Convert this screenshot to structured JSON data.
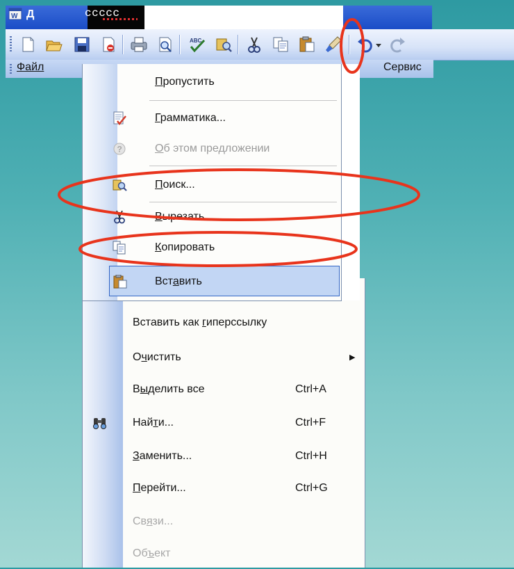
{
  "title_bar": {
    "selected_text": "ccccc",
    "window_title_fragment": "Д"
  },
  "toolbar": {
    "buttons": [
      {
        "icon": "new-document-icon"
      },
      {
        "icon": "open-folder-icon"
      },
      {
        "icon": "save-icon"
      },
      {
        "icon": "permission-icon"
      },
      {
        "icon": "print-icon"
      },
      {
        "icon": "print-preview-icon"
      },
      {
        "icon": "spelling-icon"
      },
      {
        "icon": "research-icon"
      },
      {
        "icon": "cut-icon"
      },
      {
        "icon": "copy-icon"
      },
      {
        "icon": "paste-icon"
      },
      {
        "icon": "format-painter-icon"
      },
      {
        "icon": "undo-icon"
      },
      {
        "icon": "redo-icon"
      }
    ]
  },
  "menubar": {
    "file_label": "Файл",
    "tools_label": "Сервис"
  },
  "context_menu": {
    "items": [
      {
        "label": "Пропустить",
        "underline": "П",
        "rest": "ропустить",
        "enabled": true
      },
      {
        "label": "Грамматика...",
        "underline": "Г",
        "rest": "рамматика...",
        "enabled": true,
        "icon": "grammar-icon"
      },
      {
        "label": "Об этом предложении",
        "underline": "О",
        "rest": "б этом предложении",
        "enabled": false,
        "icon": "help-icon"
      },
      {
        "label": "Поиск...",
        "underline": "П",
        "rest": "оиск...",
        "enabled": true,
        "icon": "research-icon"
      },
      {
        "label": "Вырезать",
        "underline": "В",
        "rest": "ырезать",
        "enabled": true,
        "icon": "cut-icon"
      },
      {
        "label": "Копировать",
        "underline": "К",
        "rest": "опировать",
        "enabled": true,
        "icon": "copy-icon"
      },
      {
        "label": "Вставить",
        "pre": "Вст",
        "underline": "а",
        "rest": "вить",
        "enabled": true,
        "icon": "paste-icon",
        "highlighted": true
      }
    ]
  },
  "edit_menu": {
    "items": [
      {
        "label": "Вставить как гиперссылку",
        "pre": "Вставить как ",
        "underline": "г",
        "rest": "иперссылку",
        "shortcut": "",
        "enabled": true
      },
      {
        "label": "Очистить",
        "pre": "О",
        "underline": "ч",
        "rest": "истить",
        "shortcut": "",
        "submenu": true,
        "enabled": true
      },
      {
        "label": "Выделить все",
        "pre": "В",
        "underline": "ы",
        "rest": "делить все",
        "shortcut": "Ctrl+A",
        "enabled": true
      },
      {
        "label": "Найти...",
        "pre": "Най",
        "underline": "т",
        "rest": "и...",
        "shortcut": "Ctrl+F",
        "enabled": true,
        "icon": "find-binoculars-icon"
      },
      {
        "label": "Заменить...",
        "pre": "",
        "underline": "З",
        "rest": "аменить...",
        "shortcut": "Ctrl+H",
        "enabled": true
      },
      {
        "label": "Перейти...",
        "pre": "",
        "underline": "П",
        "rest": "ерейти...",
        "shortcut": "Ctrl+G",
        "enabled": true
      },
      {
        "label": "Связи...",
        "pre": "Св",
        "underline": "я",
        "rest": "зи...",
        "shortcut": "",
        "enabled": false
      },
      {
        "label": "Объект",
        "pre": "Об",
        "underline": "ъ",
        "rest": "ект",
        "shortcut": "",
        "enabled": false
      }
    ]
  },
  "colors": {
    "annotation": "#e8341c",
    "highlight": "#c2d6f4",
    "highlight_border": "#3165c4",
    "background_top": "#2e9aa2",
    "background_bottom": "#a3d8d4"
  }
}
